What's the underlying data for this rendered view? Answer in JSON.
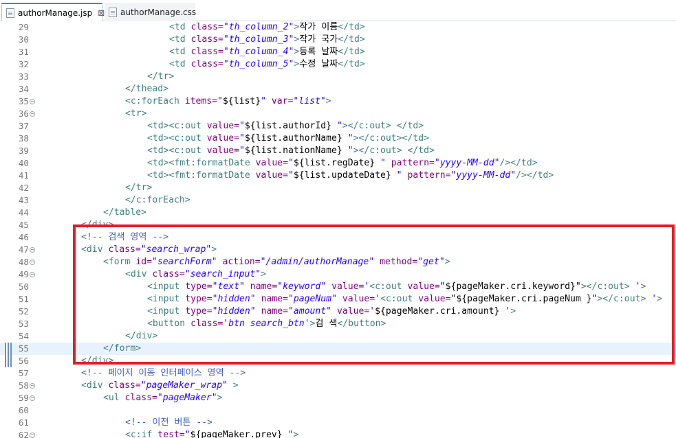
{
  "tabs": [
    {
      "label": "authorManage.jsp",
      "active": true,
      "closable": true
    },
    {
      "label": "authorManage.css",
      "active": false,
      "closable": false
    }
  ],
  "editor": {
    "current_line": 55,
    "highlighted_lines": [
      46,
      56
    ],
    "lines": [
      {
        "n": "29",
        "indent": 6,
        "fold": false,
        "segs": [
          [
            "tag",
            "<td "
          ],
          [
            "attr",
            "class="
          ],
          [
            "val",
            "\"th_column_2\""
          ],
          [
            "tag",
            ">"
          ],
          [
            "plain",
            "작가 이름"
          ],
          [
            "tag",
            "</td>"
          ]
        ]
      },
      {
        "n": "30",
        "indent": 6,
        "fold": false,
        "segs": [
          [
            "tag",
            "<td "
          ],
          [
            "attr",
            "class="
          ],
          [
            "val",
            "\"th_column_3\""
          ],
          [
            "tag",
            ">"
          ],
          [
            "plain",
            "작가 국가"
          ],
          [
            "tag",
            "</td>"
          ]
        ]
      },
      {
        "n": "31",
        "indent": 6,
        "fold": false,
        "segs": [
          [
            "tag",
            "<td "
          ],
          [
            "attr",
            "class="
          ],
          [
            "val",
            "\"th_column_4\""
          ],
          [
            "tag",
            ">"
          ],
          [
            "plain",
            "등록 날짜"
          ],
          [
            "tag",
            "</td>"
          ]
        ]
      },
      {
        "n": "32",
        "indent": 6,
        "fold": false,
        "segs": [
          [
            "tag",
            "<td "
          ],
          [
            "attr",
            "class="
          ],
          [
            "val",
            "\"th_column_5\""
          ],
          [
            "tag",
            ">"
          ],
          [
            "plain",
            "수정 날짜"
          ],
          [
            "tag",
            "</td>"
          ]
        ]
      },
      {
        "n": "33",
        "indent": 5,
        "fold": false,
        "segs": [
          [
            "tag",
            "</tr>"
          ]
        ]
      },
      {
        "n": "34",
        "indent": 4,
        "fold": false,
        "segs": [
          [
            "tag",
            "</thead>"
          ]
        ]
      },
      {
        "n": "35",
        "indent": 4,
        "fold": true,
        "segs": [
          [
            "tag",
            "<c:forEach "
          ],
          [
            "attr",
            "items="
          ],
          [
            "val",
            "\""
          ],
          [
            "plain",
            "${list}"
          ],
          [
            "val",
            "\""
          ],
          [
            "attr",
            " var="
          ],
          [
            "val",
            "\"list\""
          ],
          [
            "tag",
            ">"
          ]
        ]
      },
      {
        "n": "36",
        "indent": 4,
        "fold": true,
        "segs": [
          [
            "tag",
            "<tr>"
          ]
        ]
      },
      {
        "n": "37",
        "indent": 5,
        "fold": false,
        "segs": [
          [
            "tag",
            "<td><c:out "
          ],
          [
            "attr",
            "value="
          ],
          [
            "val",
            "\""
          ],
          [
            "plain",
            "${list.authorId}"
          ],
          [
            "val",
            " \""
          ],
          [
            "tag",
            "></c:out> </td>"
          ]
        ]
      },
      {
        "n": "38",
        "indent": 5,
        "fold": false,
        "segs": [
          [
            "tag",
            "<td><c:out "
          ],
          [
            "attr",
            "value="
          ],
          [
            "val",
            "\""
          ],
          [
            "plain",
            "${list.authorName}"
          ],
          [
            "val",
            " \""
          ],
          [
            "tag",
            "></c:out></td>"
          ]
        ]
      },
      {
        "n": "39",
        "indent": 5,
        "fold": false,
        "segs": [
          [
            "tag",
            "<td><c:out "
          ],
          [
            "attr",
            "value="
          ],
          [
            "val",
            "\""
          ],
          [
            "plain",
            "${list.nationName}"
          ],
          [
            "val",
            " \""
          ],
          [
            "tag",
            "></c:out> </td>"
          ]
        ]
      },
      {
        "n": "40",
        "indent": 5,
        "fold": false,
        "segs": [
          [
            "tag",
            "<td><fmt:formatDate "
          ],
          [
            "attr",
            "value="
          ],
          [
            "val",
            "\""
          ],
          [
            "plain",
            "${list.regDate}"
          ],
          [
            "val",
            " \""
          ],
          [
            "attr",
            " pattern="
          ],
          [
            "val",
            "\"yyyy-MM-dd\""
          ],
          [
            "tag",
            "/></td>"
          ]
        ]
      },
      {
        "n": "41",
        "indent": 5,
        "fold": false,
        "segs": [
          [
            "tag",
            "<td><fmt:formatDate "
          ],
          [
            "attr",
            "value="
          ],
          [
            "val",
            "\""
          ],
          [
            "plain",
            "${list.updateDate}"
          ],
          [
            "val",
            " \""
          ],
          [
            "attr",
            " pattern="
          ],
          [
            "val",
            "\"yyyy-MM-dd\""
          ],
          [
            "tag",
            "/></td>"
          ]
        ]
      },
      {
        "n": "42",
        "indent": 4,
        "fold": false,
        "segs": [
          [
            "tag",
            "</tr>"
          ]
        ]
      },
      {
        "n": "43",
        "indent": 4,
        "fold": false,
        "segs": [
          [
            "tag",
            "</c:forEach>"
          ]
        ]
      },
      {
        "n": "44",
        "indent": 3,
        "fold": false,
        "segs": [
          [
            "tag",
            "</table>"
          ]
        ]
      },
      {
        "n": "45",
        "indent": 2,
        "fold": false,
        "segs": [
          [
            "tag",
            "</div>"
          ]
        ]
      },
      {
        "n": "46",
        "indent": 2,
        "fold": false,
        "segs": [
          [
            "cmt",
            "<!-- 검색 영역 -->"
          ]
        ]
      },
      {
        "n": "47",
        "indent": 2,
        "fold": true,
        "segs": [
          [
            "tag",
            "<div "
          ],
          [
            "attr",
            "class="
          ],
          [
            "val",
            "\"search_wrap\""
          ],
          [
            "tag",
            ">"
          ]
        ]
      },
      {
        "n": "48",
        "indent": 3,
        "fold": true,
        "segs": [
          [
            "tag",
            "<form "
          ],
          [
            "attr",
            "id="
          ],
          [
            "val",
            "\"searchForm\""
          ],
          [
            "attr",
            " action="
          ],
          [
            "val",
            "\"/admin/authorManage\""
          ],
          [
            "attr",
            " method="
          ],
          [
            "val",
            "\"get\""
          ],
          [
            "tag",
            ">"
          ]
        ]
      },
      {
        "n": "49",
        "indent": 4,
        "fold": true,
        "segs": [
          [
            "tag",
            "<div "
          ],
          [
            "attr",
            "class="
          ],
          [
            "val",
            "\"search_input\""
          ],
          [
            "tag",
            ">"
          ]
        ]
      },
      {
        "n": "50",
        "indent": 5,
        "fold": false,
        "segs": [
          [
            "tag",
            "<input "
          ],
          [
            "attr",
            "type="
          ],
          [
            "val",
            "\"text\""
          ],
          [
            "attr",
            " name="
          ],
          [
            "val",
            "\"keyword\""
          ],
          [
            "attr",
            " value="
          ],
          [
            "val",
            "'"
          ],
          [
            "tag",
            "<c:out "
          ],
          [
            "attr",
            "value="
          ],
          [
            "plain",
            "\"${pageMaker.cri.keyword}\""
          ],
          [
            "tag",
            "></c:out>"
          ],
          [
            "val",
            " '"
          ],
          [
            "tag",
            ">"
          ]
        ]
      },
      {
        "n": "51",
        "indent": 5,
        "fold": false,
        "segs": [
          [
            "tag",
            "<input "
          ],
          [
            "attr",
            "type="
          ],
          [
            "val",
            "\"hidden\""
          ],
          [
            "attr",
            " name="
          ],
          [
            "val",
            "\"pageNum\""
          ],
          [
            "attr",
            " value="
          ],
          [
            "val",
            "'"
          ],
          [
            "tag",
            "<c:out "
          ],
          [
            "attr",
            "value="
          ],
          [
            "plain",
            "\"${pageMaker.cri.pageNum }\""
          ],
          [
            "tag",
            "></c:out>"
          ],
          [
            "val",
            " '"
          ],
          [
            "tag",
            ">"
          ]
        ]
      },
      {
        "n": "52",
        "indent": 5,
        "fold": false,
        "segs": [
          [
            "tag",
            "<input "
          ],
          [
            "attr",
            "type="
          ],
          [
            "val",
            "\"hidden\""
          ],
          [
            "attr",
            " name="
          ],
          [
            "val",
            "\"amount\""
          ],
          [
            "attr",
            " value="
          ],
          [
            "val",
            "'"
          ],
          [
            "plain",
            "${pageMaker.cri.amount}"
          ],
          [
            "val",
            " '"
          ],
          [
            "tag",
            ">"
          ]
        ]
      },
      {
        "n": "53",
        "indent": 5,
        "fold": false,
        "segs": [
          [
            "tag",
            "<button "
          ],
          [
            "attr",
            "class="
          ],
          [
            "val",
            "'btn search_btn'"
          ],
          [
            "tag",
            ">"
          ],
          [
            "plain",
            "검 색"
          ],
          [
            "tag",
            "</button>"
          ]
        ]
      },
      {
        "n": "54",
        "indent": 4,
        "fold": false,
        "segs": [
          [
            "tag",
            "</div>"
          ]
        ]
      },
      {
        "n": "55",
        "indent": 3,
        "fold": false,
        "segs": [
          [
            "tag",
            "</form>"
          ]
        ]
      },
      {
        "n": "56",
        "indent": 2,
        "fold": false,
        "segs": [
          [
            "tag",
            "</div>"
          ]
        ]
      },
      {
        "n": "57",
        "indent": 2,
        "fold": false,
        "segs": [
          [
            "cmt",
            "<!-- 페이지 이동 인터페이스 영역 -->"
          ]
        ]
      },
      {
        "n": "58",
        "indent": 2,
        "fold": true,
        "segs": [
          [
            "tag",
            "<div "
          ],
          [
            "attr",
            "class="
          ],
          [
            "val",
            "\"pageMaker_wrap\""
          ],
          [
            "tag",
            " >"
          ]
        ]
      },
      {
        "n": "59",
        "indent": 3,
        "fold": true,
        "segs": [
          [
            "tag",
            "<ul "
          ],
          [
            "attr",
            "class="
          ],
          [
            "val",
            "\"pageMaker\""
          ],
          [
            "tag",
            ">"
          ]
        ]
      },
      {
        "n": "60",
        "indent": 0,
        "fold": false,
        "segs": []
      },
      {
        "n": "61",
        "indent": 4,
        "fold": false,
        "segs": [
          [
            "cmt",
            "<!-- 이전 버튼 -->"
          ]
        ]
      },
      {
        "n": "62",
        "indent": 4,
        "fold": true,
        "segs": [
          [
            "tag",
            "<c:if "
          ],
          [
            "attr",
            "test="
          ],
          [
            "val",
            "\""
          ],
          [
            "plain",
            "${pageMaker.prev}"
          ],
          [
            "val",
            " \""
          ],
          [
            "tag",
            ">"
          ]
        ]
      }
    ]
  },
  "colors": {
    "tag": "#3f7f7f",
    "attr": "#7f007f",
    "val": "#2a00ff",
    "cmt": "#3f5fbf",
    "highlight_box": "#e31c25",
    "current_line_bg": "#e8f2fe"
  }
}
